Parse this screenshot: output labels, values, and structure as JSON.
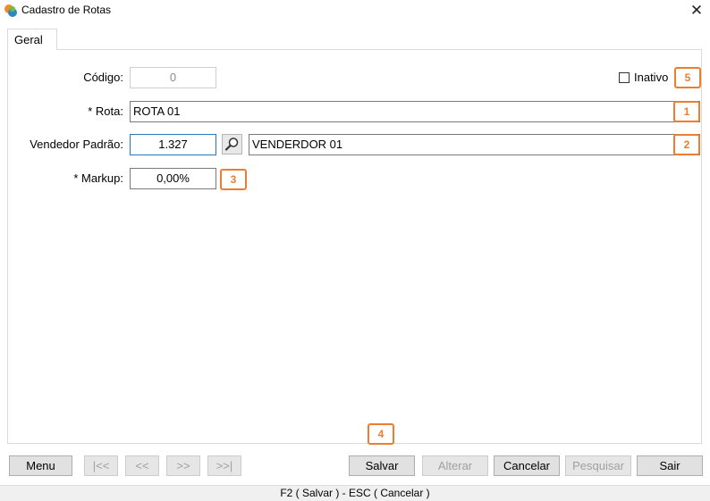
{
  "window": {
    "title": "Cadastro de Rotas",
    "close_symbol": "✕"
  },
  "tabs": [
    {
      "label": "Geral",
      "active": true
    }
  ],
  "form": {
    "codigo": {
      "label": "Código:",
      "value": "0"
    },
    "inativo": {
      "label": "Inativo",
      "checked": false
    },
    "rota": {
      "label": "* Rota:",
      "value": "ROTA 01"
    },
    "vendedor": {
      "label": "Vendedor Padrão:",
      "code": "1.327",
      "name": "VENDERDOR 01"
    },
    "markup": {
      "label": "* Markup:",
      "value": "0,00%"
    }
  },
  "callouts": [
    "1",
    "2",
    "3",
    "4",
    "5"
  ],
  "buttons": {
    "menu": "Menu",
    "first": "|<<",
    "prev": "<<",
    "next": ">>",
    "last": ">>|",
    "salvar": "Salvar",
    "alterar": "Alterar",
    "cancelar": "Cancelar",
    "pesquisar": "Pesquisar",
    "sair": "Sair"
  },
  "status": {
    "text": "F2 ( Salvar )  -  ESC ( Cancelar )"
  },
  "colors": {
    "callout": "#ee7d31",
    "focus_border": "#2877b8"
  }
}
